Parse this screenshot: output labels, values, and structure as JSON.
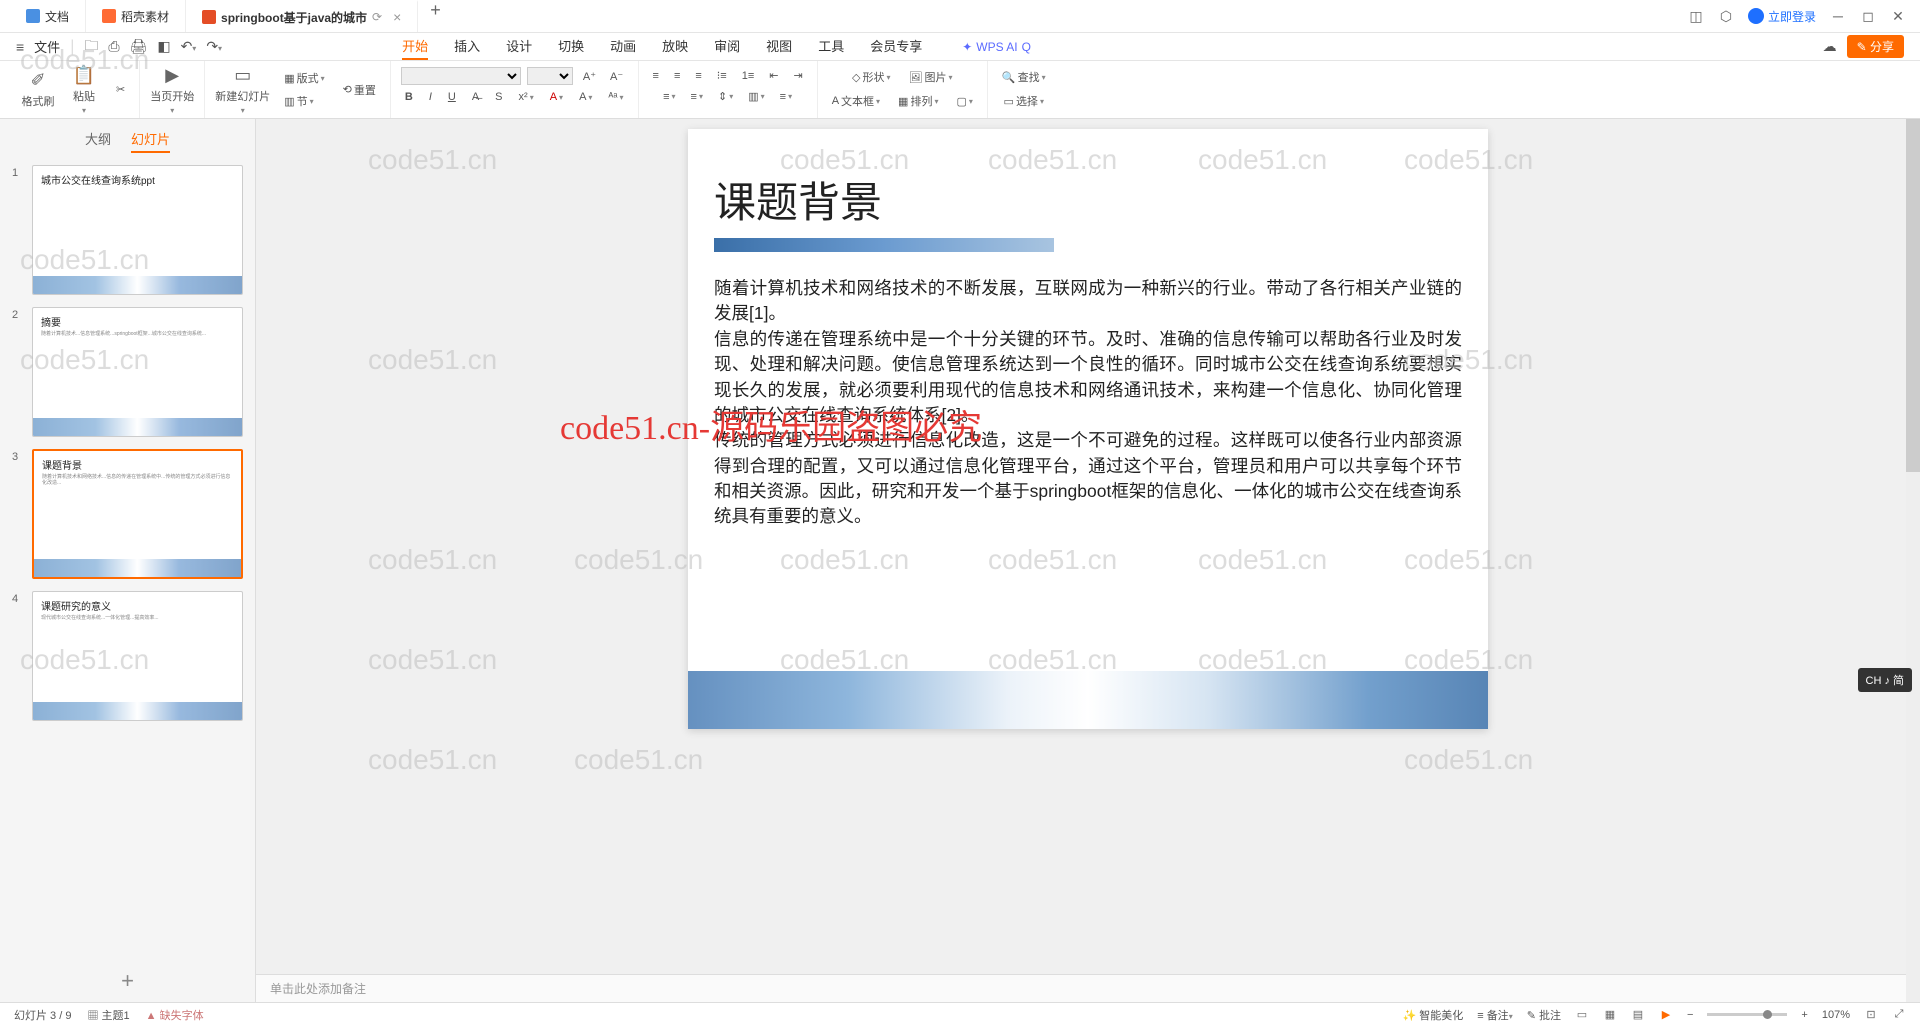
{
  "tabs": [
    {
      "label": "文档",
      "icon": "doc"
    },
    {
      "label": "稻壳素材",
      "icon": "ds"
    },
    {
      "label": "springboot基于java的城市",
      "icon": "ppt",
      "active": true
    }
  ],
  "login": "立即登录",
  "file_menu": "文件",
  "menu_tabs": [
    "开始",
    "插入",
    "设计",
    "切换",
    "动画",
    "放映",
    "审阅",
    "视图",
    "工具",
    "会员专享"
  ],
  "menu_active": 0,
  "wps_ai": "WPS AI",
  "share": "分享",
  "ribbon": {
    "format_painter": "格式刷",
    "paste": "粘贴",
    "current_page": "当页开始",
    "new_slide": "新建幻灯片",
    "layout": "版式",
    "section": "节",
    "reset": "重置",
    "shape": "形状",
    "image": "图片",
    "textbox": "文本框",
    "arrange": "排列",
    "find": "查找",
    "select": "选择"
  },
  "thumb_tabs": {
    "outline": "大纲",
    "slides": "幻灯片"
  },
  "thumbnails": [
    {
      "num": "1",
      "title": "城市公交在线查询系统ppt"
    },
    {
      "num": "2",
      "title": "摘要"
    },
    {
      "num": "3",
      "title": "课题背景",
      "selected": true
    },
    {
      "num": "4",
      "title": "课题研究的意义"
    }
  ],
  "slide": {
    "title": "课题背景",
    "p1": "随着计算机技术和网络技术的不断发展，互联网成为一种新兴的行业。带动了各行相关产业链的发展[1]。",
    "p2": "信息的传递在管理系统中是一个十分关键的环节。及时、准确的信息传输可以帮助各行业及时发现、处理和解决问题。使信息管理系统达到一个良性的循环。同时城市公交在线查询系统要想实现长久的发展，就必须要利用现代的信息技术和网络通讯技术，来构建一个信息化、协同化管理的城市公交在线查询系统体系[2]。",
    "p3": "传统的管理方式必须进行信息化改造，这是一个不可避免的过程。这样既可以使各行业内部资源得到合理的配置，又可以通过信息化管理平台，通过这个平台，管理员和用户可以共享每个环节和相关资源。因此，研究和开发一个基于springboot框架的信息化、一体化的城市公交在线查询系统具有重要的意义。"
  },
  "notes_placeholder": "单击此处添加备注",
  "status": {
    "slide_count": "幻灯片 3 / 9",
    "theme": "主题1",
    "missing_font": "缺失字体",
    "beautify": "智能美化",
    "notes": "备注",
    "annotate": "批注",
    "zoom": "107%"
  },
  "watermark": "code51.cn",
  "wm_red": "code51.cn-源码乐园盗图必究",
  "ime": "CH ♪ 简"
}
